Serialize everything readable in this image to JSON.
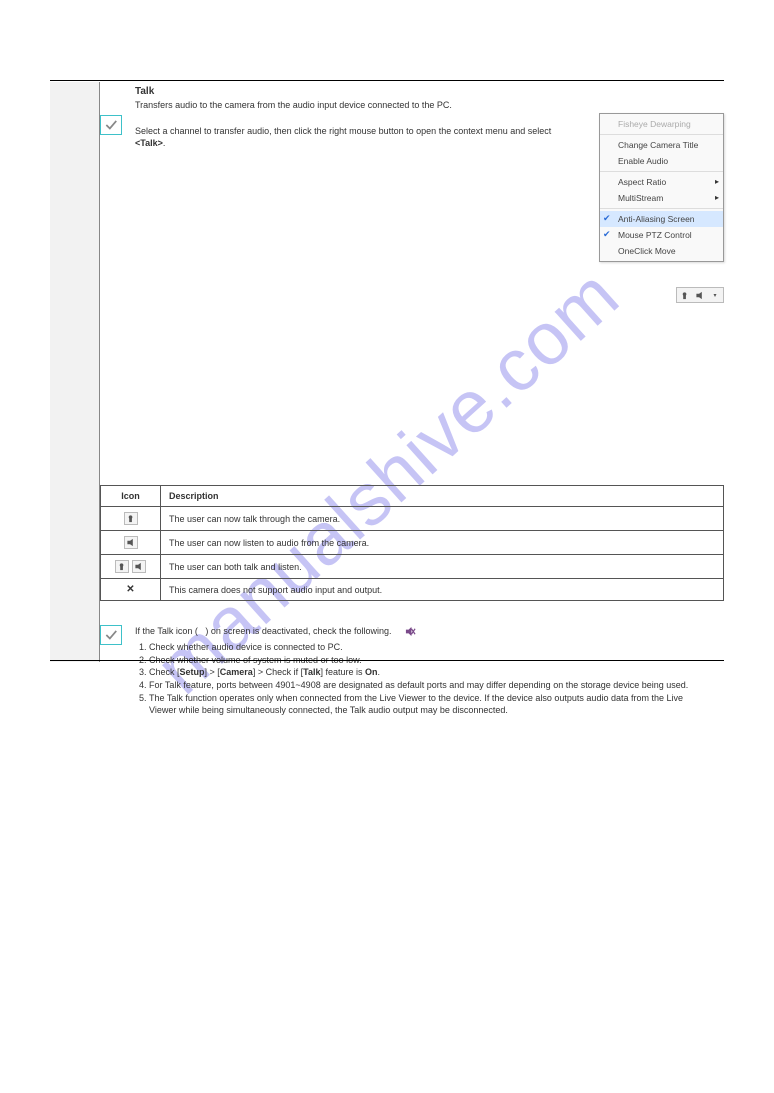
{
  "watermark": "manualshive.com",
  "menu": {
    "items": [
      {
        "label": "Fisheye Dewarping",
        "disabled": true
      },
      {
        "label": "Change Camera Title"
      },
      {
        "label": "Enable Audio"
      },
      {
        "label": "Aspect Ratio",
        "submenu": true
      },
      {
        "label": "MultiStream",
        "submenu": true
      },
      {
        "label": "Anti-Aliasing Screen",
        "checked": true,
        "hl": true
      },
      {
        "label": "Mouse PTZ Control",
        "checked": true
      },
      {
        "label": "OneClick Move"
      }
    ]
  },
  "section1": {
    "title": "Talk",
    "sub": "Transfers audio to the camera from the audio input device connected to the PC.",
    "body": {
      "lead": "Select a channel to transfer audio, then click the right mouse button to open the context menu and select ",
      "strong": "<Talk>",
      "tail": "."
    },
    "table_head": [
      "Icon",
      "Description"
    ],
    "rows": [
      {
        "icons": [
          "talk"
        ],
        "desc": "The user can now talk through the camera."
      },
      {
        "icons": [
          "listen"
        ],
        "desc": "The user can now listen to audio from the camera."
      },
      {
        "icons": [
          "talk",
          "listen"
        ],
        "desc": "The user can both talk and listen."
      },
      {
        "icons": [
          "x"
        ],
        "desc": "This camera does not support audio input and output."
      }
    ]
  },
  "section2": {
    "body": {
      "p1a": "If the Talk icon (",
      "p1b": ") on screen is deactivated, check the following.",
      "li1": "Check whether audio device is connected to PC.",
      "li2": "Check whether volume of system is muted or too low.",
      "li3a": "Check [",
      "li3b": "] > [",
      "li3c": "] > Check if [",
      "li3d": "] feature is ",
      "li3e": ".",
      "li3_setup": "Setup",
      "li3_camera": "Camera",
      "li3_talk": "Talk",
      "li3_on": "On",
      "li4": "For Talk feature, ports between 4901~4908 are designated as default ports and may differ depending on the storage device being used.",
      "li5": "The Talk function operates only when connected from the Live Viewer to the device. If the device also outputs audio data from the Live Viewer while being simultaneously connected, the Talk audio output may be disconnected."
    }
  }
}
